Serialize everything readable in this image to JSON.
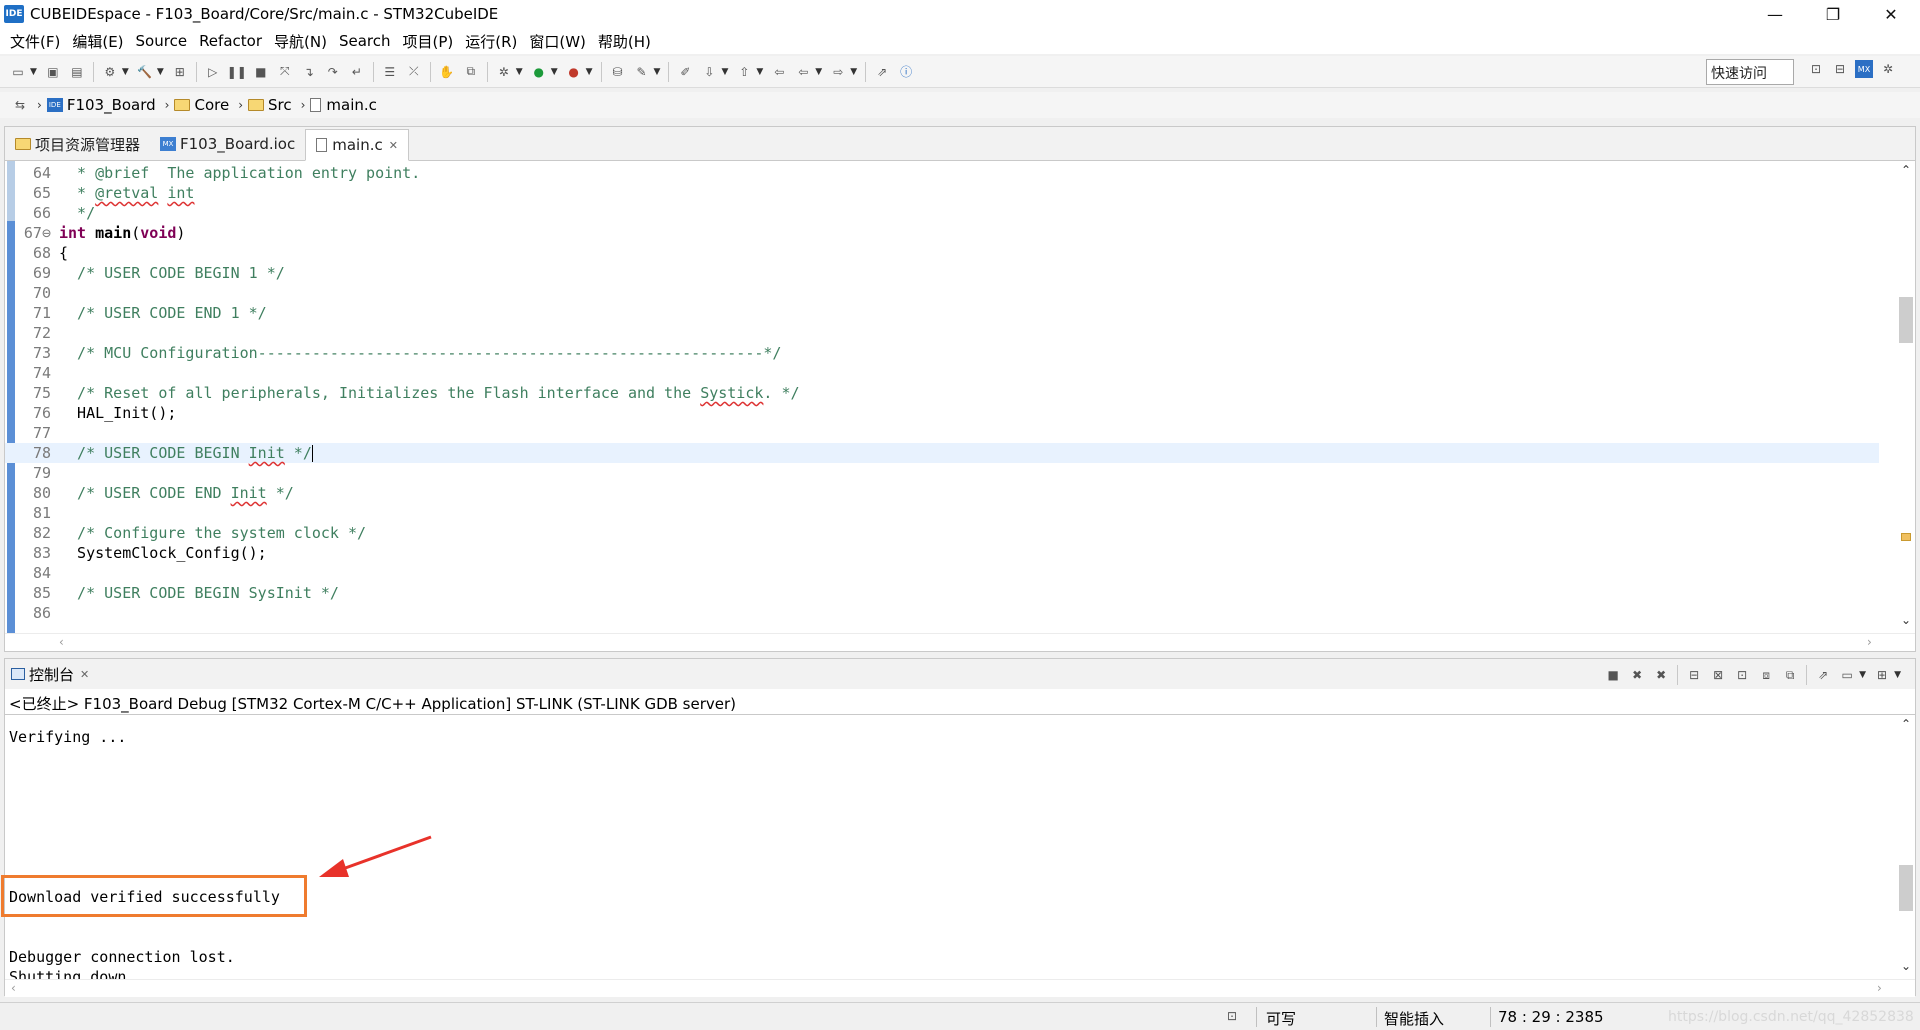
{
  "window": {
    "app_icon_text": "IDE",
    "title": "CUBEIDEspace - F103_Board/Core/Src/main.c - STM32CubeIDE",
    "minimize": "—",
    "restore": "❐",
    "close": "✕"
  },
  "menu": [
    "文件(F)",
    "编辑(E)",
    "Source",
    "Refactor",
    "导航(N)",
    "Search",
    "项目(P)",
    "运行(R)",
    "窗口(W)",
    "帮助(H)"
  ],
  "toolbar": {
    "quick_access": "快速访问"
  },
  "breadcrumb": {
    "project": "F103_Board",
    "folder1": "Core",
    "folder2": "Src",
    "file": "main.c"
  },
  "editor_tabs": [
    {
      "label": "项目资源管理器",
      "icon": "folder-icon"
    },
    {
      "label": "F103_Board.ioc",
      "icon": "mx-icon"
    },
    {
      "label": "main.c",
      "icon": "file-icon",
      "active": true
    }
  ],
  "code_lines": [
    {
      "n": "64",
      "text": "  * @brief  The application entry point."
    },
    {
      "n": "65",
      "text": "  * @retval int"
    },
    {
      "n": "66",
      "text": "  */"
    },
    {
      "n": "67⊖",
      "text": "int main(void)"
    },
    {
      "n": "68",
      "text": "{"
    },
    {
      "n": "69",
      "text": "  /* USER CODE BEGIN 1 */"
    },
    {
      "n": "70",
      "text": ""
    },
    {
      "n": "71",
      "text": "  /* USER CODE END 1 */"
    },
    {
      "n": "72",
      "text": ""
    },
    {
      "n": "73",
      "text": "  /* MCU Configuration--------------------------------------------------------*/"
    },
    {
      "n": "74",
      "text": ""
    },
    {
      "n": "75",
      "text": "  /* Reset of all peripherals, Initializes the Flash interface and the Systick. */"
    },
    {
      "n": "76",
      "text": "  HAL_Init();"
    },
    {
      "n": "77",
      "text": ""
    },
    {
      "n": "78",
      "text": "  /* USER CODE BEGIN Init */"
    },
    {
      "n": "79",
      "text": ""
    },
    {
      "n": "80",
      "text": "  /* USER CODE END Init */"
    },
    {
      "n": "81",
      "text": ""
    },
    {
      "n": "82",
      "text": "  /* Configure the system clock */"
    },
    {
      "n": "83",
      "text": "  SystemClock_Config();"
    },
    {
      "n": "84",
      "text": ""
    },
    {
      "n": "85",
      "text": "  /* USER CODE BEGIN SysInit */"
    },
    {
      "n": "86",
      "text": ""
    }
  ],
  "console": {
    "tab_label": "控制台",
    "header": "<已终止> F103_Board Debug [STM32 Cortex-M C/C++ Application] ST-LINK (ST-LINK GDB server)",
    "lines": [
      "Verifying ...",
      "Download verified successfully",
      "Debugger connection lost.",
      "Shutting down..."
    ]
  },
  "status": {
    "writable": "可写",
    "insert_mode": "智能插入",
    "position": "78 : 29 : 2385",
    "watermark": "https://blog.csdn.net/qq_42852838"
  },
  "colors": {
    "comment": "#3f7f5f",
    "keyword": "#7f0055",
    "highlight_box": "#ef7b2e",
    "arrow": "#e8322a"
  }
}
